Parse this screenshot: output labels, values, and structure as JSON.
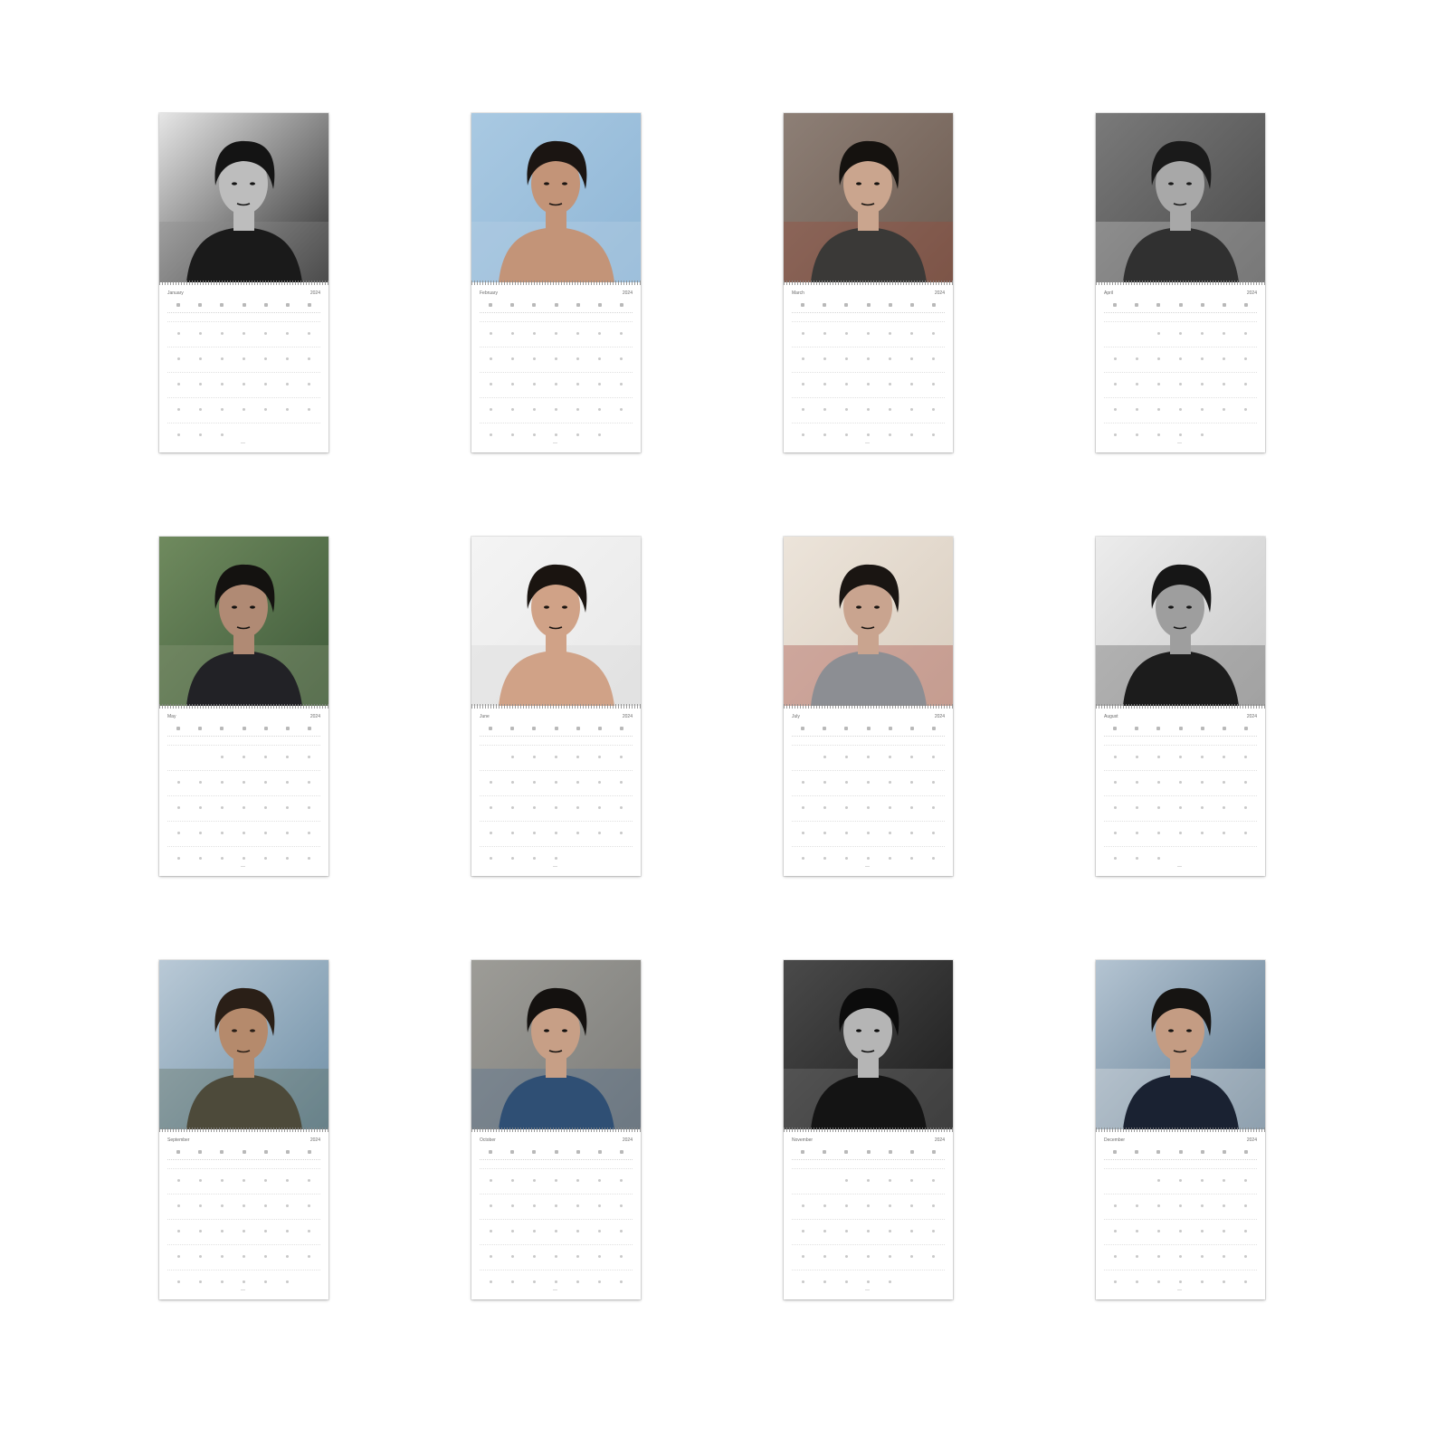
{
  "months": [
    {
      "name": "January",
      "year": "2024",
      "photo": {
        "bg": "#2b2b2b",
        "tone": "#e6e6e6",
        "hair": "#141414",
        "skin": "#bdbdbd",
        "cloth": "#1a1a1a",
        "accent": "#8a8a8a"
      }
    },
    {
      "name": "February",
      "year": "2024",
      "photo": {
        "bg": "#8fb6d6",
        "tone": "#a9c9e2",
        "hair": "#1b1512",
        "skin": "#c39478",
        "cloth": "#c39478",
        "accent": "#b9d2e6"
      }
    },
    {
      "name": "March",
      "year": "2024",
      "photo": {
        "bg": "#6d5a4f",
        "tone": "#8d7f76",
        "hair": "#15120f",
        "skin": "#caa58e",
        "cloth": "#3a3937",
        "accent": "#9c4a3a"
      }
    },
    {
      "name": "April",
      "year": "2024",
      "photo": {
        "bg": "#4a4a4a",
        "tone": "#7a7a7a",
        "hair": "#1a1a1a",
        "skin": "#a8a8a8",
        "cloth": "#303030",
        "accent": "#cfcfcf"
      }
    },
    {
      "name": "May",
      "year": "2024",
      "photo": {
        "bg": "#3f5a3a",
        "tone": "#6f8a5e",
        "hair": "#141210",
        "skin": "#b08a74",
        "cloth": "#222226",
        "accent": "#8d9c7b"
      }
    },
    {
      "name": "June",
      "year": "2024",
      "photo": {
        "bg": "#e8e8e8",
        "tone": "#f4f4f4",
        "hair": "#1a1410",
        "skin": "#d0a287",
        "cloth": "#d0a287",
        "accent": "#d6d6d6"
      }
    },
    {
      "name": "July",
      "year": "2024",
      "photo": {
        "bg": "#d9cdbf",
        "tone": "#ece4da",
        "hair": "#1a1512",
        "skin": "#c9a48f",
        "cloth": "#8c8e93",
        "accent": "#a0433a"
      }
    },
    {
      "name": "August",
      "year": "2024",
      "photo": {
        "bg": "#c9c9c9",
        "tone": "#ececec",
        "hair": "#161616",
        "skin": "#9e9e9e",
        "cloth": "#1c1c1c",
        "accent": "#5a5a5a"
      }
    },
    {
      "name": "September",
      "year": "2024",
      "photo": {
        "bg": "#6f8fa6",
        "tone": "#b9c9d6",
        "hair": "#2a1f17",
        "skin": "#b58a6c",
        "cloth": "#4d4a3a",
        "accent": "#5b6a55"
      }
    },
    {
      "name": "October",
      "year": "2024",
      "photo": {
        "bg": "#7d7d7a",
        "tone": "#9d9c97",
        "hair": "#14110f",
        "skin": "#c79f86",
        "cloth": "#2f4f74",
        "accent": "#4f6f93"
      }
    },
    {
      "name": "November",
      "year": "2024",
      "photo": {
        "bg": "#1d1d1d",
        "tone": "#4a4a4a",
        "hair": "#0c0c0c",
        "skin": "#b5b5b5",
        "cloth": "#141414",
        "accent": "#7d7d7d"
      }
    },
    {
      "name": "December",
      "year": "2024",
      "photo": {
        "bg": "#5f7a90",
        "tone": "#b4c4d2",
        "hair": "#161412",
        "skin": "#c49c83",
        "cloth": "#1a2232",
        "accent": "#e8e8e8"
      }
    }
  ]
}
